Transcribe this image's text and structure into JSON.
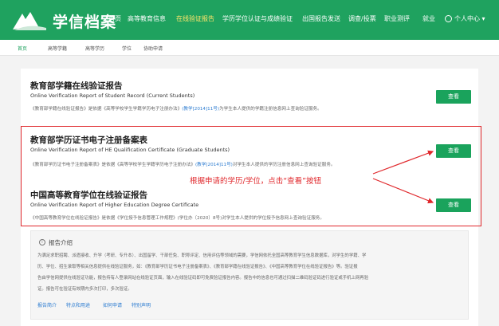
{
  "header": {
    "brand": "学信档案",
    "nav": [
      "首页",
      "高等教育信息",
      "在线验证报告",
      "学历学位认证与成绩验证",
      "出国报告发送",
      "调查/投票",
      "职业测评",
      "就业"
    ],
    "active_nav": "在线验证报告",
    "user_menu": "个人中心 ▾"
  },
  "subnav": {
    "items": [
      "首页",
      "高等学籍",
      "高等学历",
      "学位",
      "协助申请"
    ],
    "active": "首页"
  },
  "reports": [
    {
      "title": "教育部学籍在线验证报告",
      "subtitle": "Online Verification Report of Student Record (Current Students)",
      "desc_pre": "《教育部学籍在线验证报告》是依据《高等学校学生学籍学历电子注册办法》",
      "desc_link": "(教学[2014]11号)",
      "desc_post": "为学生本人提供的学籍注册信息网上查询验证服务。",
      "button": "查看"
    },
    {
      "title": "教育部学历证书电子注册备案表",
      "subtitle": "Online Verification Report of HE Qualification Certificate (Graduate Students)",
      "desc_pre": "《教育部学历证书电子注册备案表》是依据《高等学校学生学籍学历电子注册办法》",
      "desc_link": "(教学[2014]11号)",
      "desc_post": "对学生本人提供的学历注册信息网上查询验证服务。",
      "button": "查看"
    },
    {
      "title": "中国高等教育学位在线验证报告",
      "subtitle": "Online Verification Report of Higher Education Degree Certificate",
      "desc_pre": "《中国高等教育学位在线验证报告》是依据《学位授予信息管理工作规程》(学位办〔2020〕8号)对学生本人提供的学位授予信息网上查询验证服务。",
      "desc_link": "",
      "desc_post": "",
      "button": "查看"
    }
  ],
  "annotation": "根据申请的学历/学位，点击“查看”按钮",
  "intro": {
    "title": "报告介绍",
    "lines": [
      "为满足求职招聘、派遣接收、升学（考研、专升本）、出国留学、干部任免、职称评定、信用评估等领域的需要，学信网依托全国高等教育学生信息数据库，对学生的学籍、学",
      "历、学位、招生录取等相关信息提供在线验证服务，如：《教育部学历证书电子注册备案表》、《教育部学籍在线验证报告》、《中国高等教育学位在线验证报告》等。验证报",
      "告由学信网提供在线验证功能，报告持有人登录网站在线验证页面，输入在线验证码即可免费验证报告内容。报告中的信息也可通过扫描二维码验证码进行验证或手机上网再验",
      "证。报告可在验证有效期内多次打印，多次验证。"
    ],
    "links": [
      "报告简介",
      "特点和用途",
      "如何申请",
      "特别声明"
    ]
  }
}
